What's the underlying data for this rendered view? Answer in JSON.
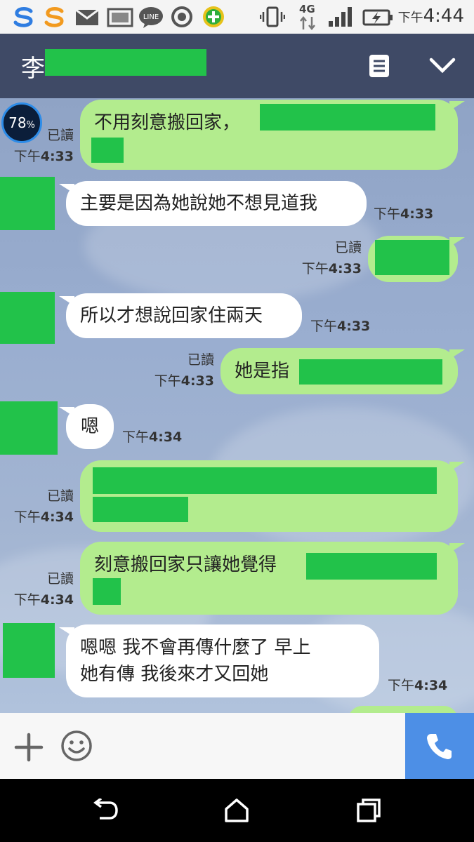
{
  "status_bar": {
    "time_prefix": "下午",
    "time": "4:44",
    "network": "4G"
  },
  "header": {
    "contact_name": "李"
  },
  "messages": [
    {
      "side": "me",
      "text": "不用刻意搬回家，",
      "read": "已讀",
      "time_prefix": "下午",
      "time": "4:33"
    },
    {
      "side": "them",
      "text": "主要是因為她說她不想見道我",
      "time_prefix": "下午",
      "time": "4:33"
    },
    {
      "side": "me",
      "text": "",
      "read": "已讀",
      "time_prefix": "下午",
      "time": "4:33"
    },
    {
      "side": "them",
      "text": "所以才想說回家住兩天",
      "time_prefix": "下午",
      "time": "4:33"
    },
    {
      "side": "me",
      "text": "她是指",
      "read": "已讀",
      "time_prefix": "下午",
      "time": "4:33"
    },
    {
      "side": "them",
      "text": "嗯",
      "time_prefix": "下午",
      "time": "4:34"
    },
    {
      "side": "me",
      "text": "",
      "read": "已讀",
      "time_prefix": "下午",
      "time": "4:34"
    },
    {
      "side": "me",
      "text": "刻意搬回家只讓她覺得",
      "read": "已讀",
      "time_prefix": "下午",
      "time": "4:34"
    },
    {
      "side": "them",
      "text_line1": "嗯嗯  我不會再傳什麼了  早上",
      "text_line2": "她有傳  我後來才又回她",
      "time_prefix": "下午",
      "time": "4:34"
    }
  ],
  "overlay": {
    "battery_percent": "78",
    "percent_sign": "%"
  },
  "colors": {
    "header_bg": "#3f4a66",
    "my_bubble": "#b3ec8e",
    "their_bubble": "#ffffff",
    "redaction": "#22c24a",
    "call_button": "#4d8fe6"
  }
}
